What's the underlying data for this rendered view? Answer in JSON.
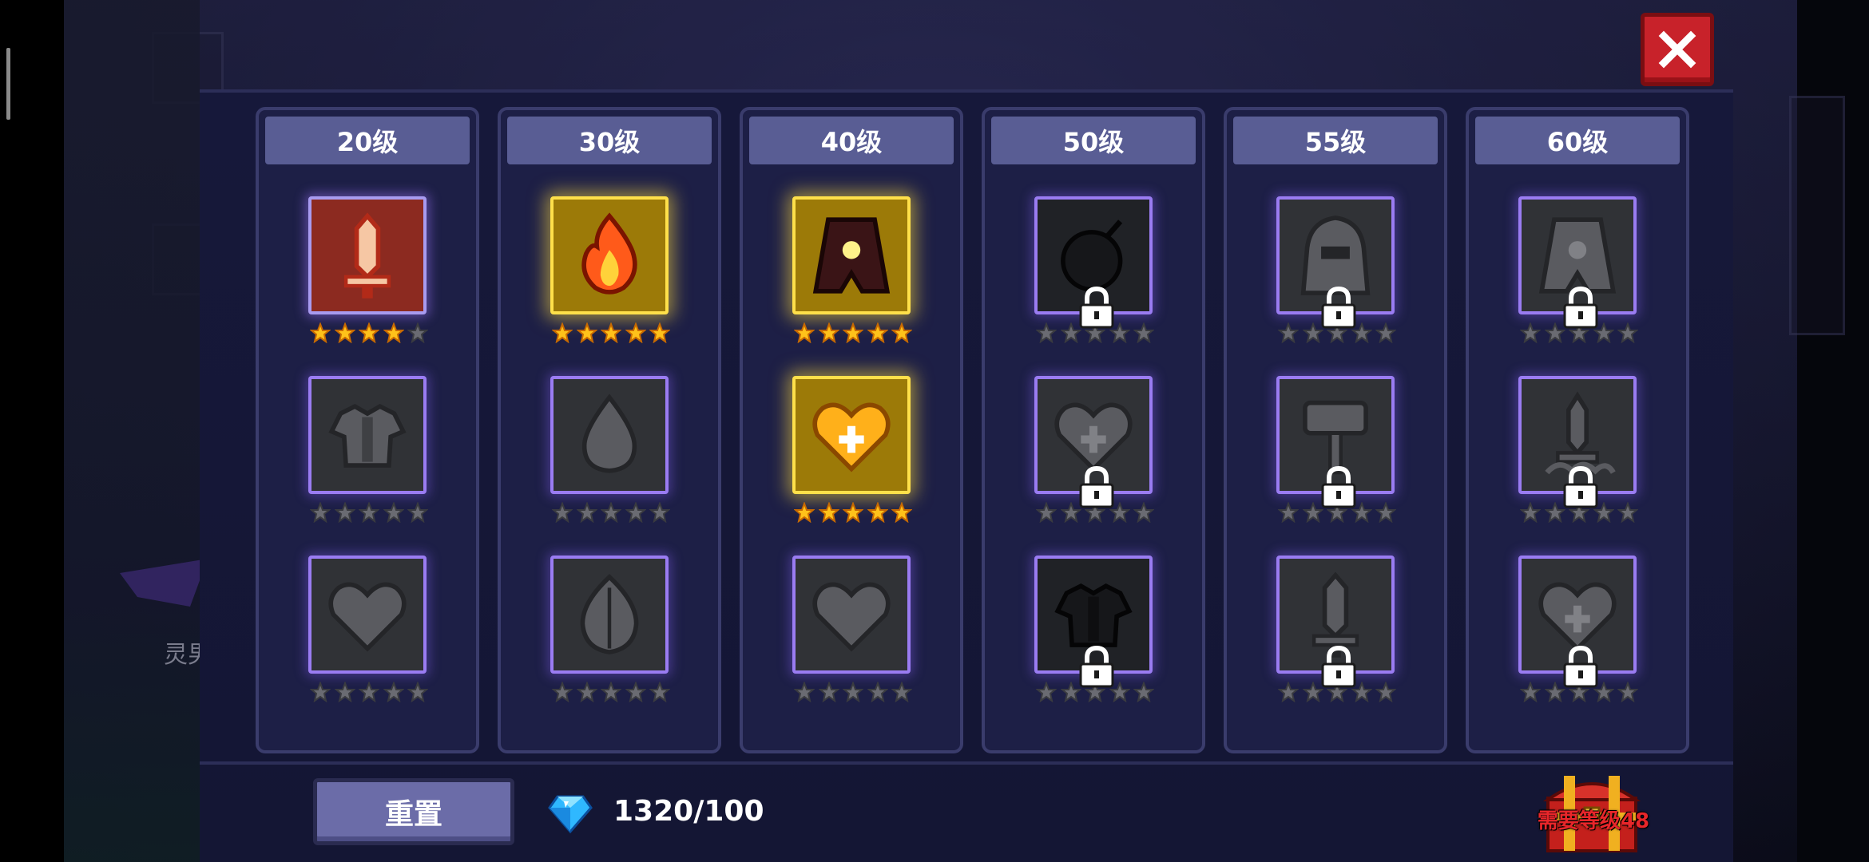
{
  "colors": {
    "panel_bg": "#16183a",
    "column_bg": "#1d1f46",
    "header_bg": "#595d94",
    "slot_border": "#9a7cf2",
    "gold": "#ffd23a",
    "close_red": "#c8222a",
    "chest_label": "#e8262a"
  },
  "background": {
    "partial_label": "灵男"
  },
  "close_button": {
    "icon": "close-icon"
  },
  "columns": [
    {
      "level": "20级",
      "slots": [
        {
          "icon": "sword-talent-icon",
          "state": "active-red",
          "stars_filled": 4,
          "stars_total": 5,
          "locked": false
        },
        {
          "icon": "armor-talent-icon",
          "state": "inactive",
          "stars_filled": 0,
          "stars_total": 5,
          "locked": false
        },
        {
          "icon": "heart-talent-icon",
          "state": "inactive",
          "stars_filled": 0,
          "stars_total": 5,
          "locked": false
        }
      ]
    },
    {
      "level": "30级",
      "slots": [
        {
          "icon": "fire-talent-icon",
          "state": "active-gold",
          "stars_filled": 5,
          "stars_total": 5,
          "locked": false
        },
        {
          "icon": "drop-talent-icon",
          "state": "inactive",
          "stars_filled": 0,
          "stars_total": 5,
          "locked": false
        },
        {
          "icon": "leaf-talent-icon",
          "state": "inactive",
          "stars_filled": 0,
          "stars_total": 5,
          "locked": false
        }
      ]
    },
    {
      "level": "40级",
      "slots": [
        {
          "icon": "cloak-talent-icon",
          "state": "active-gold",
          "stars_filled": 5,
          "stars_total": 5,
          "locked": false
        },
        {
          "icon": "heart-plus-talent-icon",
          "state": "active-gold",
          "stars_filled": 5,
          "stars_total": 5,
          "locked": false
        },
        {
          "icon": "heart-talent-icon",
          "state": "inactive",
          "stars_filled": 0,
          "stars_total": 5,
          "locked": false
        }
      ]
    },
    {
      "level": "50级",
      "slots": [
        {
          "icon": "bomb-talent-icon",
          "state": "locked-dark",
          "stars_filled": 0,
          "stars_total": 5,
          "locked": true
        },
        {
          "icon": "heart-plus-talent-icon",
          "state": "inactive",
          "stars_filled": 0,
          "stars_total": 5,
          "locked": true
        },
        {
          "icon": "armor-talent-icon",
          "state": "locked-dark",
          "stars_filled": 0,
          "stars_total": 5,
          "locked": true
        }
      ]
    },
    {
      "level": "55级",
      "slots": [
        {
          "icon": "hood-talent-icon",
          "state": "inactive",
          "stars_filled": 0,
          "stars_total": 5,
          "locked": true
        },
        {
          "icon": "hammer-talent-icon",
          "state": "inactive",
          "stars_filled": 0,
          "stars_total": 5,
          "locked": true
        },
        {
          "icon": "sword-talent-icon",
          "state": "inactive",
          "stars_filled": 0,
          "stars_total": 5,
          "locked": true
        }
      ]
    },
    {
      "level": "60级",
      "slots": [
        {
          "icon": "cloak-talent-icon",
          "state": "inactive",
          "stars_filled": 0,
          "stars_total": 5,
          "locked": true
        },
        {
          "icon": "sword-smoke-talent-icon",
          "state": "inactive",
          "stars_filled": 0,
          "stars_total": 5,
          "locked": true
        },
        {
          "icon": "heart-plus-talent-icon",
          "state": "inactive",
          "stars_filled": 0,
          "stars_total": 5,
          "locked": true
        }
      ]
    }
  ],
  "footer": {
    "reset_label": "重置",
    "gem_icon": "gem-icon",
    "gem_count": "1320/100",
    "chest_icon": "treasure-chest-icon",
    "chest_label": "需要等级48"
  }
}
